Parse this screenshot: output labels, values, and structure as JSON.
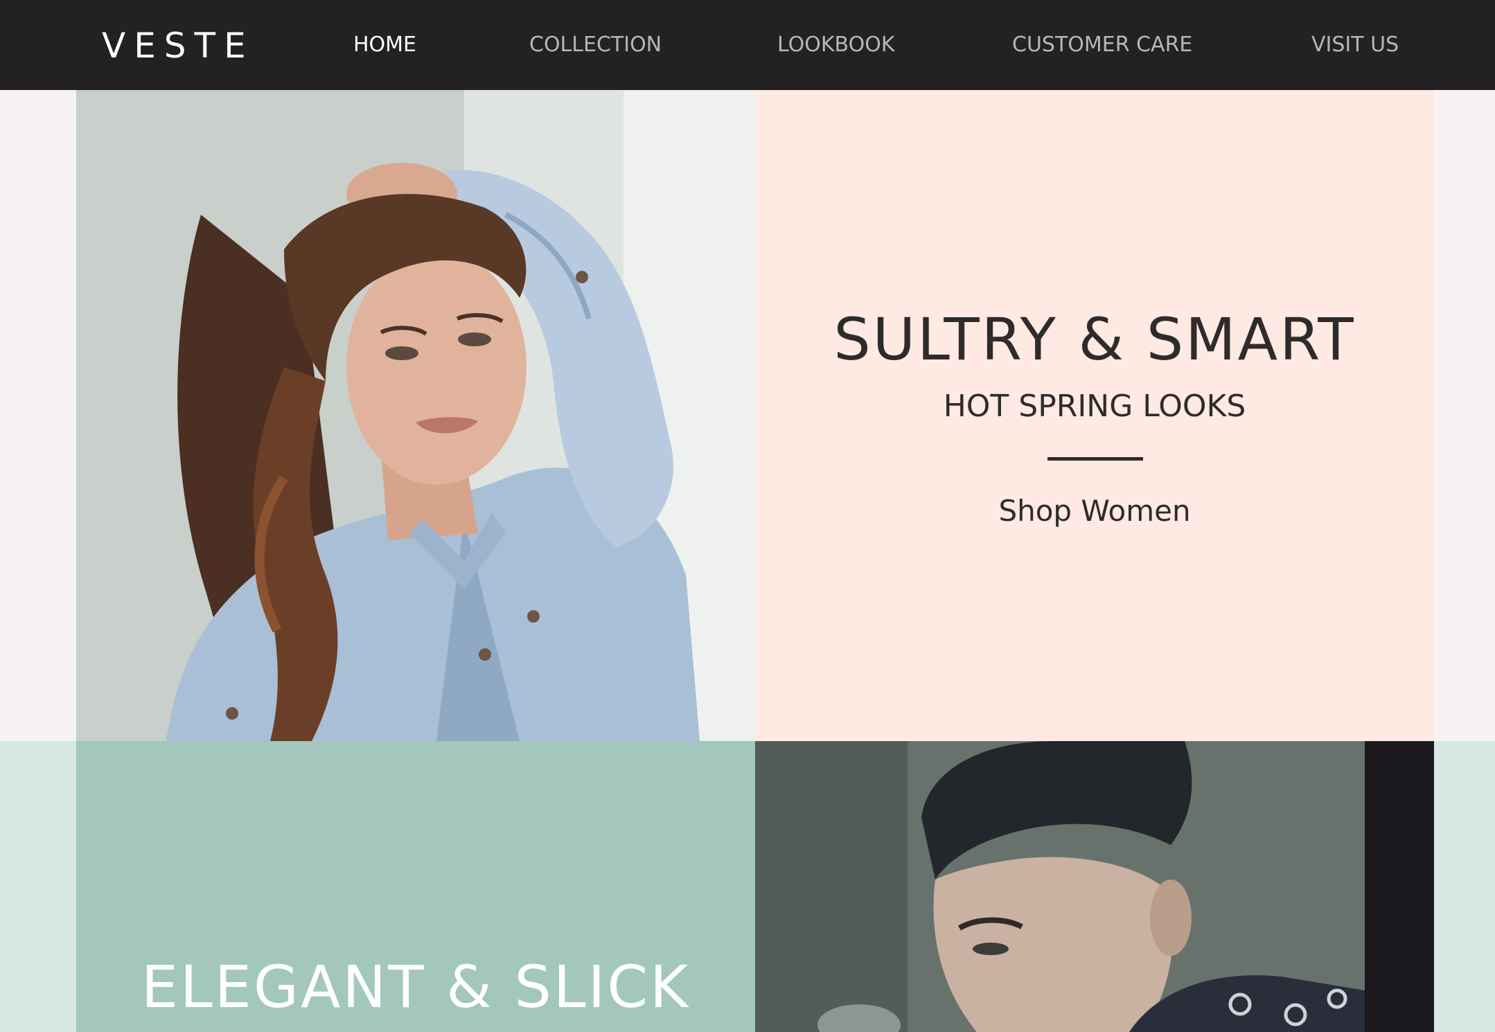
{
  "header": {
    "logo": "VESTE",
    "nav": [
      {
        "label": "HOME",
        "active": true
      },
      {
        "label": "COLLECTION",
        "active": false
      },
      {
        "label": "LOOKBOOK",
        "active": false
      },
      {
        "label": "CUSTOMER CARE",
        "active": false
      },
      {
        "label": "VISIT US",
        "active": false
      }
    ]
  },
  "hero_women": {
    "title": "SULTRY & SMART",
    "subtitle": "HOT SPRING LOOKS",
    "link": "Shop Women"
  },
  "hero_men": {
    "title": "ELEGANT & SLICK"
  },
  "colors": {
    "header_bg": "#232123",
    "nav_active": "#ffffff",
    "nav_inactive": "#b9b6b6",
    "women_panel": "#fee9e3",
    "men_panel": "#a3c7bd",
    "text_dark": "#2e2b2b"
  }
}
